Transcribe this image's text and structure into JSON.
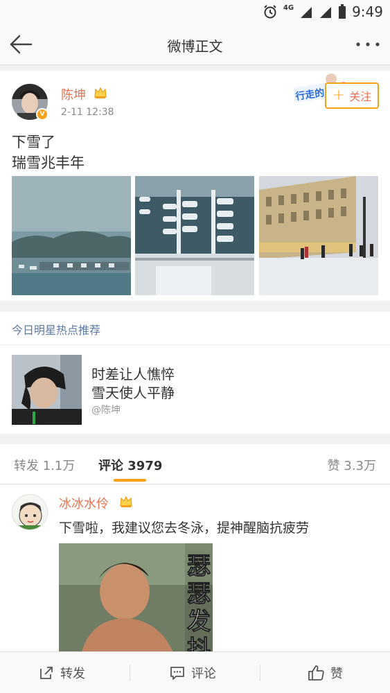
{
  "status_bar": {
    "time": "9:49",
    "network": "4G"
  },
  "nav": {
    "title": "微博正文"
  },
  "post": {
    "author": "陈坤",
    "time": "2-11 12:38",
    "verified_badge": "V",
    "follow_label": "关注",
    "promo_text": "行走的",
    "text_line1": "下雪了",
    "text_line2": "瑞雪兆丰年",
    "photos": [
      "foggy-snowy-harbor-photo",
      "snowy-marina-photo",
      "snowy-street-building-photo"
    ]
  },
  "recommend": {
    "header": "今日明星热点推荐",
    "line1": "时差让人憔悴",
    "line2": "雪天使人平静",
    "source": "@陈坤"
  },
  "tabs": {
    "repost": "转发 1.1万",
    "comment": "评论 3979",
    "like": "赞 3.3万"
  },
  "comment": {
    "author": "冰冰水伶",
    "text": "下雪啦，我建议您去冬泳，提神醒脑抗疲劳",
    "image_caption": "瑟瑟发抖"
  },
  "bottom_bar": {
    "repost": "转发",
    "comment": "评论",
    "like": "赞"
  },
  "colors": {
    "accent_orange": "#f7a11a",
    "name_orange": "#eb7350",
    "link_blue": "#5b7aa3"
  }
}
